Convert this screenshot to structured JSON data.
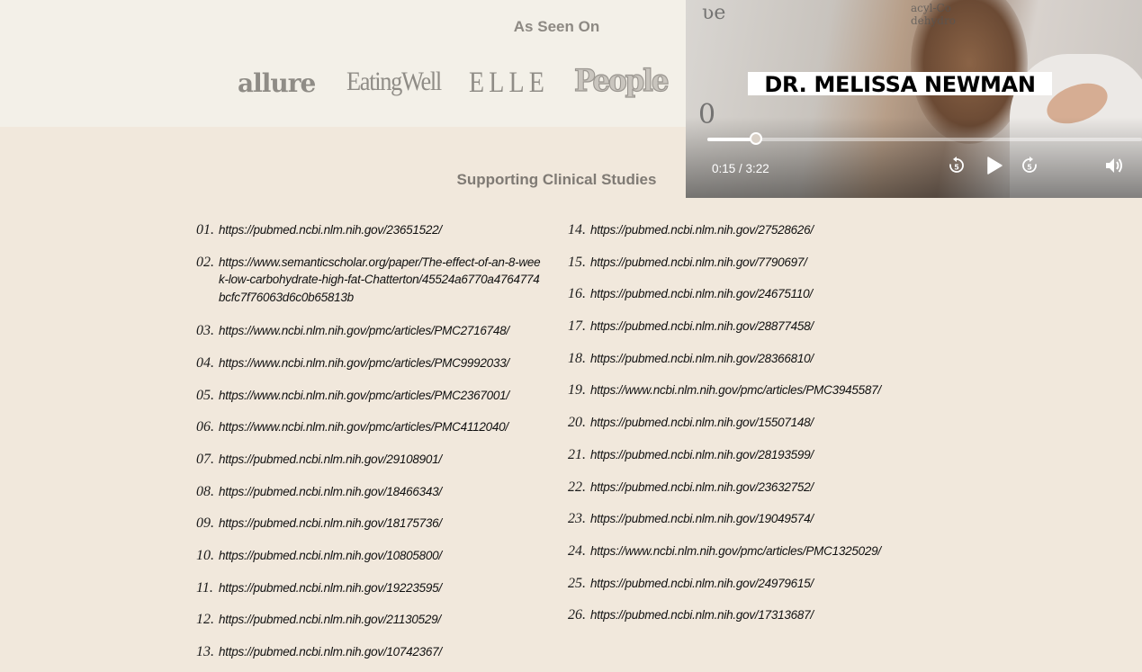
{
  "seen_on": {
    "title": "As Seen On",
    "logos": [
      "allure",
      "EatingWell",
      "ELLE",
      "People"
    ]
  },
  "studies": {
    "title": "Supporting Clinical Studies",
    "left": [
      {
        "num": "01.",
        "url": "https://pubmed.ncbi.nlm.nih.gov/23651522/"
      },
      {
        "num": "02.",
        "url": "https://www.semanticscholar.org/paper/The-effect-of-an-8-week-low-carbohydrate-high-fat-Chatterton/45524a6770a4764774bcfc7f76063d6c0b65813b"
      },
      {
        "num": "03.",
        "url": "https://www.ncbi.nlm.nih.gov/pmc/articles/PMC2716748/"
      },
      {
        "num": "04.",
        "url": "https://www.ncbi.nlm.nih.gov/pmc/articles/PMC9992033/"
      },
      {
        "num": "05.",
        "url": "https://www.ncbi.nlm.nih.gov/pmc/articles/PMC2367001/"
      },
      {
        "num": "06.",
        "url": "https://www.ncbi.nlm.nih.gov/pmc/articles/PMC4112040/"
      },
      {
        "num": "07.",
        "url": "https://pubmed.ncbi.nlm.nih.gov/29108901/"
      },
      {
        "num": "08.",
        "url": "https://pubmed.ncbi.nlm.nih.gov/18466343/"
      },
      {
        "num": "09.",
        "url": "https://pubmed.ncbi.nlm.nih.gov/18175736/"
      },
      {
        "num": "10.",
        "url": "https://pubmed.ncbi.nlm.nih.gov/10805800/"
      },
      {
        "num": "11.",
        "url": "https://pubmed.ncbi.nlm.nih.gov/19223595/"
      },
      {
        "num": "12.",
        "url": "https://pubmed.ncbi.nlm.nih.gov/21130529/"
      },
      {
        "num": "13.",
        "url": "https://pubmed.ncbi.nlm.nih.gov/10742367/"
      }
    ],
    "right": [
      {
        "num": "14.",
        "url": "https://pubmed.ncbi.nlm.nih.gov/27528626/"
      },
      {
        "num": "15.",
        "url": "https://pubmed.ncbi.nlm.nih.gov/7790697/"
      },
      {
        "num": "16.",
        "url": "https://pubmed.ncbi.nlm.nih.gov/24675110/"
      },
      {
        "num": "17.",
        "url": "https://pubmed.ncbi.nlm.nih.gov/28877458/"
      },
      {
        "num": "18.",
        "url": "https://pubmed.ncbi.nlm.nih.gov/28366810/"
      },
      {
        "num": "19.",
        "url": "https://www.ncbi.nlm.nih.gov/pmc/articles/PMC3945587/"
      },
      {
        "num": "20.",
        "url": "https://pubmed.ncbi.nlm.nih.gov/15507148/"
      },
      {
        "num": "21.",
        "url": "https://pubmed.ncbi.nlm.nih.gov/28193599/"
      },
      {
        "num": "22.",
        "url": "https://pubmed.ncbi.nlm.nih.gov/23632752/"
      },
      {
        "num": "23.",
        "url": "https://pubmed.ncbi.nlm.nih.gov/19049574/"
      },
      {
        "num": "24.",
        "url": "https://www.ncbi.nlm.nih.gov/pmc/articles/PMC1325029/"
      },
      {
        "num": "25.",
        "url": "https://pubmed.ncbi.nlm.nih.gov/24979615/"
      },
      {
        "num": "26.",
        "url": "https://pubmed.ncbi.nlm.nih.gov/17313687/"
      }
    ]
  },
  "video": {
    "banner": "DR. MELISSA NEWMAN",
    "current_time": "0:15",
    "duration": "3:22",
    "time_display": "0:15 / 3:22",
    "progress_fraction": 0.074,
    "icons": [
      "rewind-5-icon",
      "play-icon",
      "forward-5-icon",
      "volume-icon"
    ]
  }
}
